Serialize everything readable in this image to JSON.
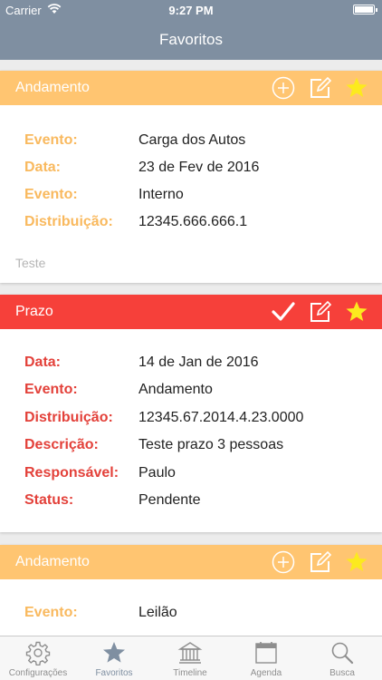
{
  "status": {
    "carrier": "Carrier",
    "time": "9:27 PM"
  },
  "nav": {
    "title": "Favoritos"
  },
  "colors": {
    "andamento": "#ffc571",
    "andamento_label": "#f9b95e",
    "prazo": "#f6403a",
    "prazo_label": "#e3413a",
    "star": "#fcea1e",
    "nav": "#7f8fa1"
  },
  "cards": [
    {
      "title": "Andamento",
      "icons": [
        "add-circle-icon",
        "edit-icon",
        "star-icon"
      ],
      "fields": [
        {
          "label": "Evento:",
          "value": "Carga dos Autos"
        },
        {
          "label": "Data:",
          "value": "23 de Fev de 2016"
        },
        {
          "label": "Evento:",
          "value": "Interno"
        },
        {
          "label": "Distribuição:",
          "value": "12345.666.666.1"
        }
      ],
      "note": "Teste"
    },
    {
      "title": "Prazo",
      "icons": [
        "checkmark-icon",
        "edit-icon",
        "star-icon"
      ],
      "fields": [
        {
          "label": "Data:",
          "value": "14 de Jan de 2016"
        },
        {
          "label": "Evento:",
          "value": "Andamento"
        },
        {
          "label": "Distribuição:",
          "value": "12345.67.2014.4.23.0000"
        },
        {
          "label": "Descrição:",
          "value": "Teste prazo 3 pessoas"
        },
        {
          "label": "Responsável:",
          "value": "Paulo"
        },
        {
          "label": "Status:",
          "value": "Pendente"
        }
      ]
    },
    {
      "title": "Andamento",
      "icons": [
        "add-circle-icon",
        "edit-icon",
        "star-icon"
      ],
      "fields": [
        {
          "label": "Evento:",
          "value": "Leilão"
        }
      ]
    }
  ],
  "tabs": [
    {
      "label": "Configurações",
      "icon": "gear-icon"
    },
    {
      "label": "Favoritos",
      "icon": "star-icon",
      "active": true
    },
    {
      "label": "Timeline",
      "icon": "courthouse-icon"
    },
    {
      "label": "Agenda",
      "icon": "calendar-icon"
    },
    {
      "label": "Busca",
      "icon": "search-icon"
    }
  ]
}
